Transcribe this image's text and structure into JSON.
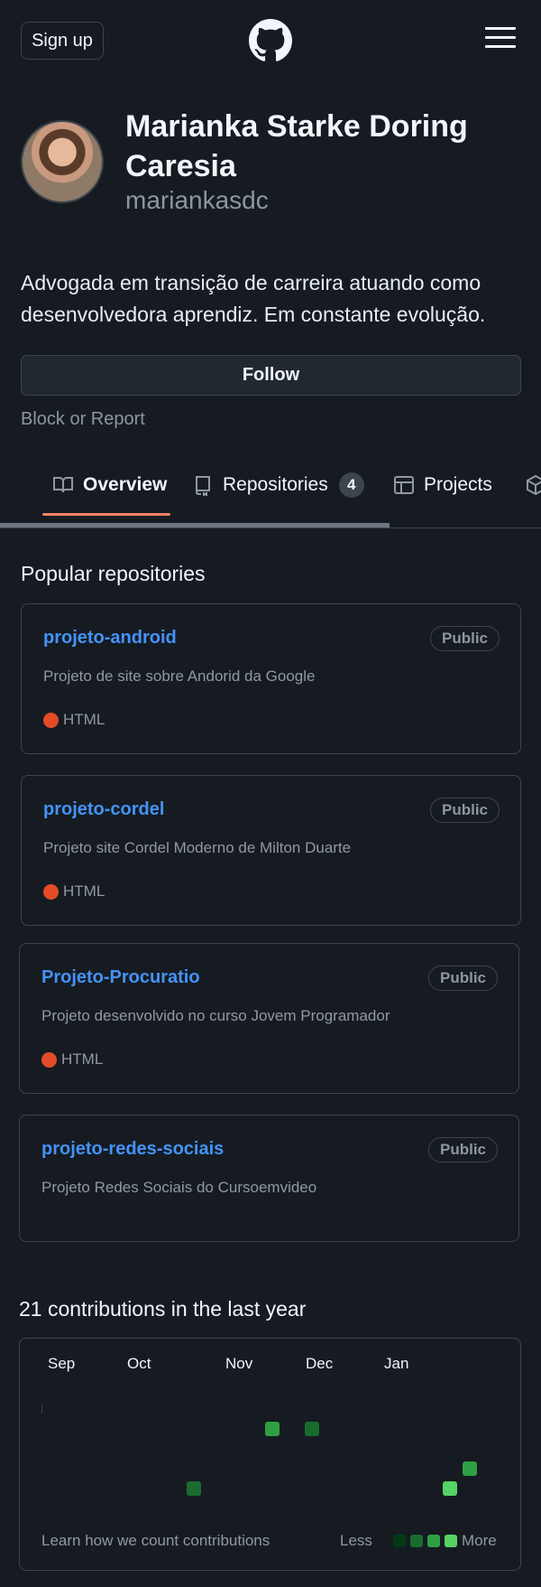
{
  "header": {
    "signup_label": "Sign up",
    "logo_icon": "github-mark-icon",
    "menu_icon": "hamburger-menu-icon"
  },
  "profile": {
    "full_name": "Marianka Starke Doring Caresia",
    "username": "mariankasdc",
    "bio": "Advogada em transição de carreira atuando como desenvolvedora aprendiz. Em constante evolução.",
    "follow_label": "Follow",
    "block_report_label": "Block or Report"
  },
  "tabs": [
    {
      "label": "Overview",
      "icon": "book-icon",
      "selected": true
    },
    {
      "label": "Repositories",
      "icon": "repo-icon",
      "count": "4"
    },
    {
      "label": "Projects",
      "icon": "table-icon"
    },
    {
      "label": "",
      "icon": "package-icon"
    }
  ],
  "popular": {
    "title": "Popular repositories",
    "repos": [
      {
        "name": "projeto-android",
        "visibility": "Public",
        "description": "Projeto de site sobre Andorid da Google",
        "language": "HTML"
      },
      {
        "name": "projeto-cordel",
        "visibility": "Public",
        "description": "Projeto site Cordel Moderno de Milton Duarte",
        "language": "HTML"
      },
      {
        "name": "Projeto-Procuratio",
        "visibility": "Public",
        "description": "Projeto desenvolvido no curso Jovem Programador",
        "language": "HTML"
      },
      {
        "name": "projeto-redes-sociais",
        "visibility": "Public",
        "description": "Projeto Redes Sociais do Cursoemvideo",
        "language": ""
      }
    ]
  },
  "contributions": {
    "title": "21 contributions in the last year",
    "months": [
      "Sep",
      "Oct",
      "Nov",
      "Dec",
      "Jan"
    ],
    "footer_link": "Learn how we count contributions",
    "legend_less": "Less",
    "legend_more": "More",
    "colors": {
      "level1": "#033a16",
      "level2": "#196c2e",
      "level3": "#2ea043",
      "level4": "#56d364",
      "language_html": "#e34c26",
      "accent_link": "#4493f8",
      "tab_underline": "#f78166"
    }
  }
}
